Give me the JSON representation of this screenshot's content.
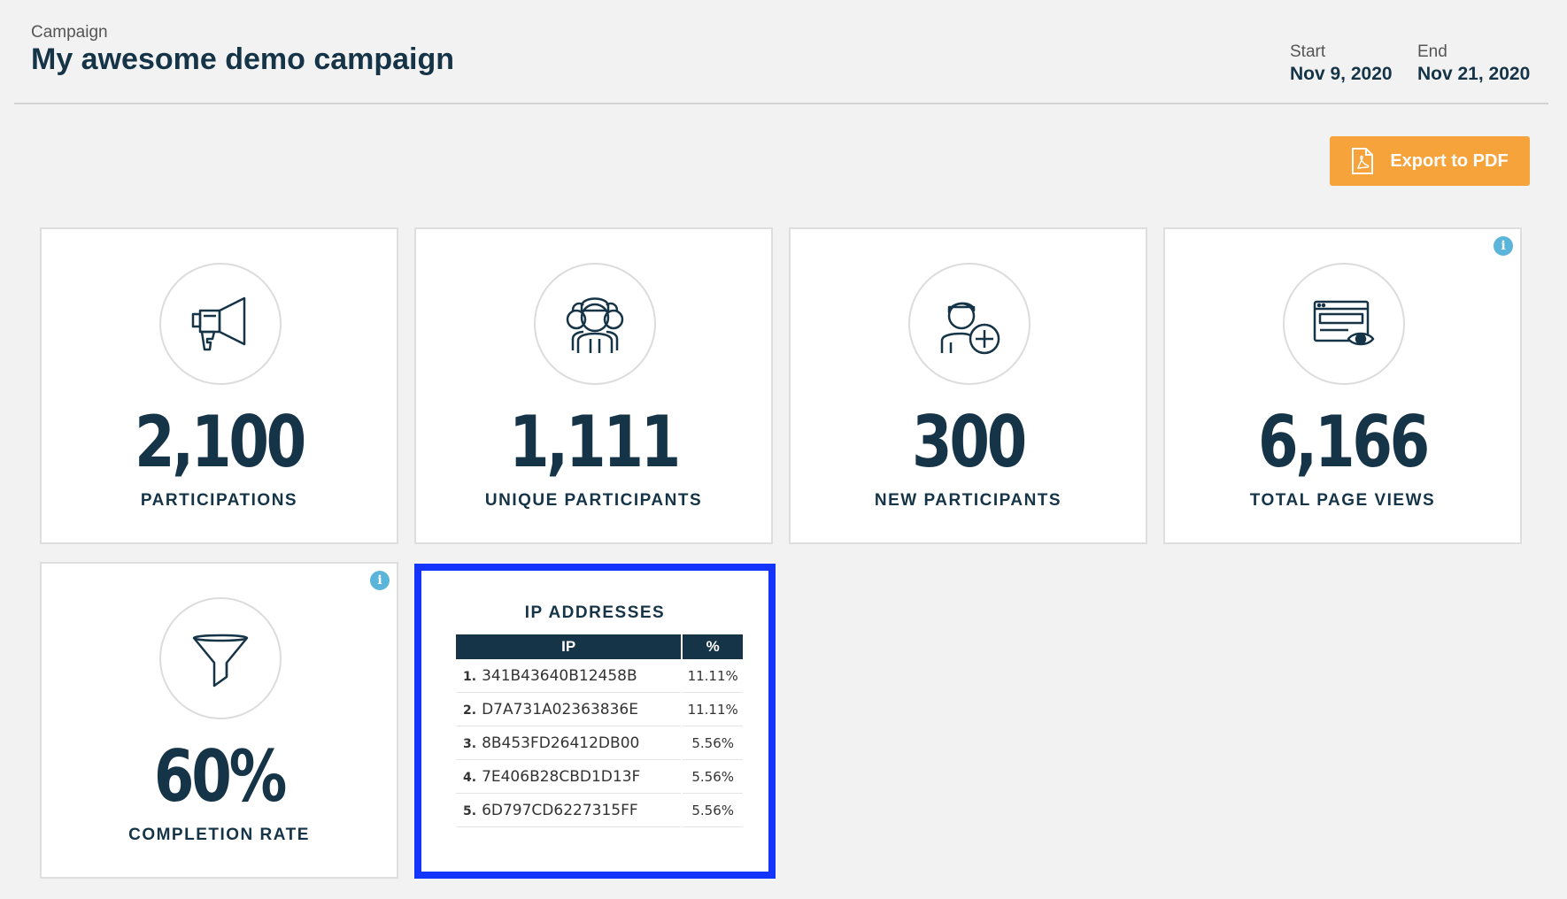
{
  "header": {
    "eyebrow": "Campaign",
    "title": "My awesome demo campaign",
    "start_label": "Start",
    "start_date": "Nov 9, 2020",
    "end_label": "End",
    "end_date": "Nov 21, 2020"
  },
  "export_button": {
    "label": "Export to PDF",
    "icon": "pdf-file-icon"
  },
  "metrics": [
    {
      "value": "2,100",
      "label": "PARTICIPATIONS",
      "icon": "megaphone-icon",
      "info": false
    },
    {
      "value": "1,111",
      "label": "UNIQUE PARTICIPANTS",
      "icon": "group-icon",
      "info": false
    },
    {
      "value": "300",
      "label": "NEW PARTICIPANTS",
      "icon": "add-user-icon",
      "info": false
    },
    {
      "value": "6,166",
      "label": "TOTAL PAGE VIEWS",
      "icon": "page-view-icon",
      "info": true
    },
    {
      "value": "60%",
      "label": "COMPLETION RATE",
      "icon": "funnel-icon",
      "info": true
    }
  ],
  "info_icon_glyph": "i",
  "ip_addresses": {
    "title": "IP ADDRESSES",
    "columns": [
      "IP",
      "%"
    ],
    "rows": [
      {
        "rank": "1.",
        "ip": "341B43640B12458B",
        "pct": "11.11%"
      },
      {
        "rank": "2.",
        "ip": "D7A731A02363836E",
        "pct": "11.11%"
      },
      {
        "rank": "3.",
        "ip": "8B453FD26412DB00",
        "pct": "5.56%"
      },
      {
        "rank": "4.",
        "ip": "7E406B28CBD1D13F",
        "pct": "5.56%"
      },
      {
        "rank": "5.",
        "ip": "6D797CD6227315FF",
        "pct": "5.56%"
      }
    ]
  },
  "colors": {
    "navy": "#163447",
    "orange": "#f7a33b",
    "info_blue": "#5bb4d9",
    "highlight_blue": "#1434ff",
    "background": "#f2f2f2"
  }
}
